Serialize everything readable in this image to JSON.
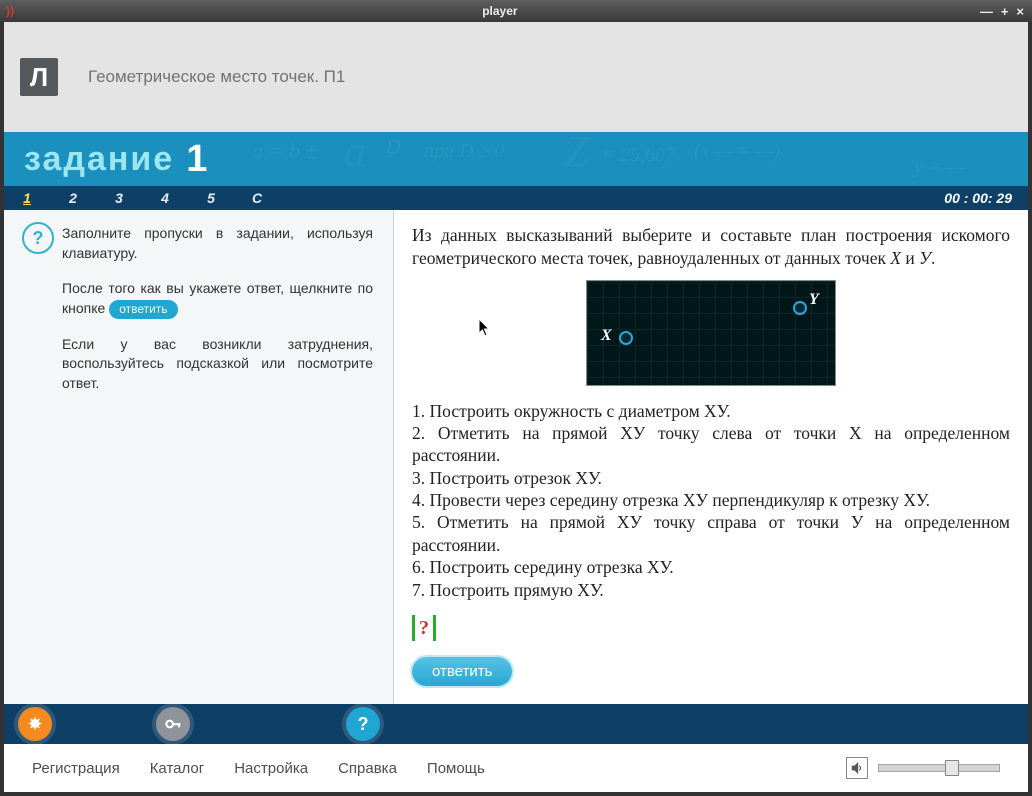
{
  "window": {
    "title": "player"
  },
  "header": {
    "lesson": "Геометрическое место точек. П1",
    "task_label": "задание",
    "task_number": "1"
  },
  "nav": {
    "items": [
      "1",
      "2",
      "3",
      "4",
      "5",
      "С"
    ],
    "selected": "1",
    "timer": "00 : 00: 29"
  },
  "instructions": {
    "p1": "Заполните пропуски в задании, используя клавиатуру.",
    "p2a": "После того как вы укажете ответ, щелкните по кнопке ",
    "p2_btn": "ответить",
    "p3": "Если у вас возникли затруднения, воспользуйтесь подсказкой или посмотрите ответ."
  },
  "question": {
    "intro": "Из данных высказываний выберите и составьте план построения искомого геометрического места точек, равноудаленных от данных точек X и У.",
    "options": [
      "1. Построить окружность с диаметром ХУ.",
      "2. Отметить на прямой  ХУ точку слева от точки Х на определенном расстоянии.",
      "3. Построить отрезок  ХУ.",
      "4. Провести через середину отрезка  ХУ перпендикуляр к отрезку ХУ.",
      "5. Отметить на прямой  ХУ точку справа от точки У на определенном расстоянии.",
      "6. Построить середину отрезка  ХУ.",
      "7. Построить прямую ХУ."
    ],
    "answer_placeholder": "?",
    "answer_button": "ответить"
  },
  "plot": {
    "labelX": "X",
    "labelY": "Y"
  },
  "bottom_icons": {
    "orange": "✸",
    "key": "⚿",
    "help": "?"
  },
  "footer": {
    "menu": [
      "Регистрация",
      "Каталог",
      "Настройка",
      "Справка",
      "Помощь"
    ],
    "speaker": "🔊"
  }
}
